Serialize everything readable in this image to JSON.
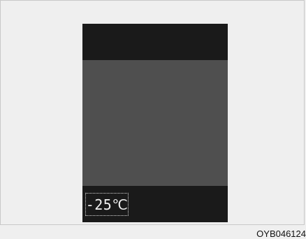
{
  "display": {
    "outside_temperature": "-25℃"
  },
  "caption": {
    "image_code": "OYB046124"
  }
}
